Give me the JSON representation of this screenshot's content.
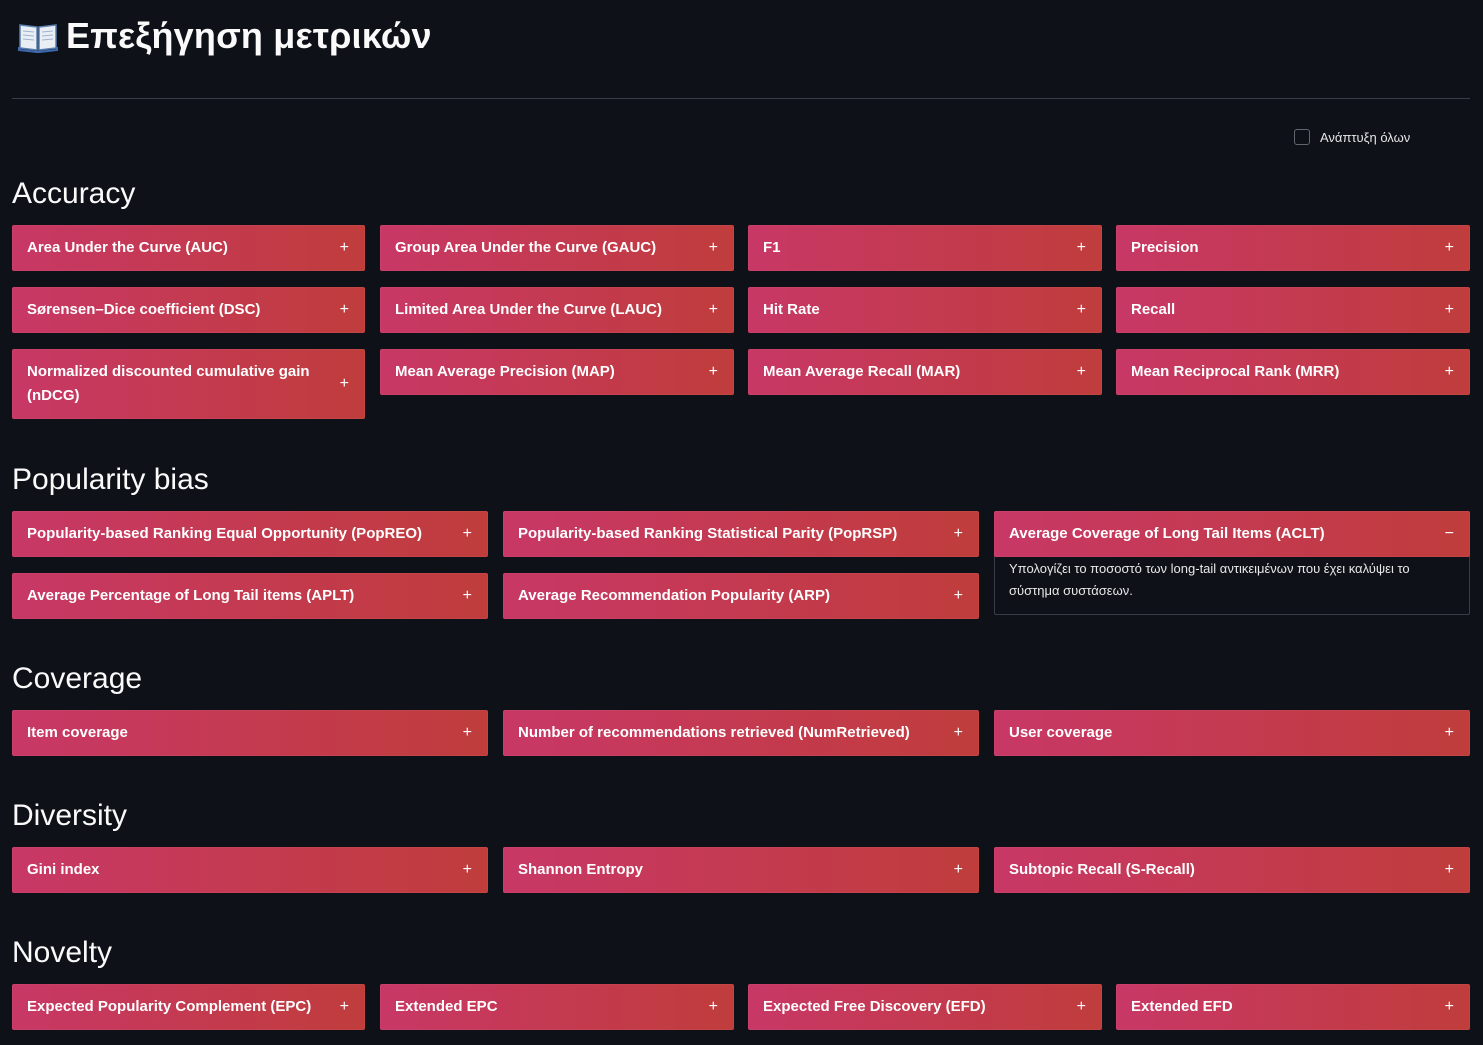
{
  "header": {
    "title": "Επεξήγηση μετρικών",
    "icon": "open-book-icon"
  },
  "controls": {
    "expand_all_label": "Ανάπτυξη όλων",
    "expand_all_checked": false
  },
  "colors": {
    "background": "#0e1117",
    "card_gradient_start": "#c83866",
    "card_gradient_end": "#c03d3c",
    "divider": "#3a3d47"
  },
  "sections": {
    "accuracy": {
      "heading": "Accuracy",
      "items": [
        {
          "label": "Area Under the Curve (AUC)",
          "toggle": "+"
        },
        {
          "label": "Group Area Under the Curve (GAUC)",
          "toggle": "+"
        },
        {
          "label": "F1",
          "toggle": "+"
        },
        {
          "label": "Precision",
          "toggle": "+"
        },
        {
          "label": "Sørensen–Dice coefficient (DSC)",
          "toggle": "+"
        },
        {
          "label": "Limited Area Under the Curve (LAUC)",
          "toggle": "+"
        },
        {
          "label": "Hit Rate",
          "toggle": "+"
        },
        {
          "label": "Recall",
          "toggle": "+"
        },
        {
          "label": "Normalized discounted cumulative gain (nDCG)",
          "toggle": "+"
        },
        {
          "label": "Mean Average Precision (MAP)",
          "toggle": "+"
        },
        {
          "label": "Mean Average Recall (MAR)",
          "toggle": "+"
        },
        {
          "label": "Mean Reciprocal Rank (MRR)",
          "toggle": "+"
        }
      ]
    },
    "popularity": {
      "heading": "Popularity bias",
      "items": [
        {
          "label": "Popularity-based Ranking Equal Opportunity (PopREO)",
          "toggle": "+"
        },
        {
          "label": "Popularity-based Ranking Statistical Parity (PopRSP)",
          "toggle": "+"
        },
        {
          "label": "Average Coverage of Long Tail Items (ACLT)",
          "toggle": "−",
          "expanded": true,
          "description": "Υπολογίζει το ποσοστό των long-tail αντικειμένων που έχει καλύψει το σύστημα συστάσεων."
        },
        {
          "label": "Average Percentage of Long Tail items (APLT)",
          "toggle": "+"
        },
        {
          "label": "Average Recommendation Popularity (ARP)",
          "toggle": "+"
        }
      ]
    },
    "coverage": {
      "heading": "Coverage",
      "items": [
        {
          "label": "Item coverage",
          "toggle": "+"
        },
        {
          "label": "Number of recommendations retrieved (NumRetrieved)",
          "toggle": "+"
        },
        {
          "label": "User coverage",
          "toggle": "+"
        }
      ]
    },
    "diversity": {
      "heading": "Diversity",
      "items": [
        {
          "label": "Gini index",
          "toggle": "+"
        },
        {
          "label": "Shannon Entropy",
          "toggle": "+"
        },
        {
          "label": "Subtopic Recall (S-Recall)",
          "toggle": "+"
        }
      ]
    },
    "novelty": {
      "heading": "Novelty",
      "items": [
        {
          "label": "Expected Popularity Complement (EPC)",
          "toggle": "+"
        },
        {
          "label": "Extended EPC",
          "toggle": "+"
        },
        {
          "label": "Expected Free Discovery (EFD)",
          "toggle": "+"
        },
        {
          "label": "Extended EFD",
          "toggle": "+"
        }
      ]
    }
  }
}
